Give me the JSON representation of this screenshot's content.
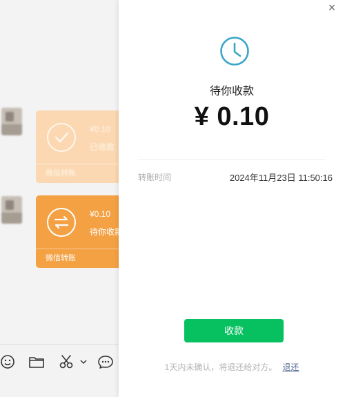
{
  "chat": {
    "received_card": {
      "amount": "¥0.10",
      "sub": "已收款",
      "footer": "微信转账"
    },
    "pending_card": {
      "amount": "¥0.10",
      "sub": "待你收款",
      "footer": "微信转账"
    },
    "toolbar_icons": [
      "emoji-icon",
      "folder-icon",
      "scissors-icon",
      "chat-icon"
    ]
  },
  "panel": {
    "status": "待你收款",
    "amount": "¥ 0.10",
    "transfer_time_label": "转账时间",
    "transfer_time_value": "2024年11月23日 11:50:16",
    "collect_button": "收款",
    "notice": "1天内未确认，将退还给对方。",
    "return_link": "退还"
  },
  "colors": {
    "accent_green": "#07c160",
    "transfer_orange": "#f4a144",
    "transfer_orange_light": "#fbd8b1",
    "clock_teal": "#3aa6c8",
    "link_blue": "#576b95"
  }
}
